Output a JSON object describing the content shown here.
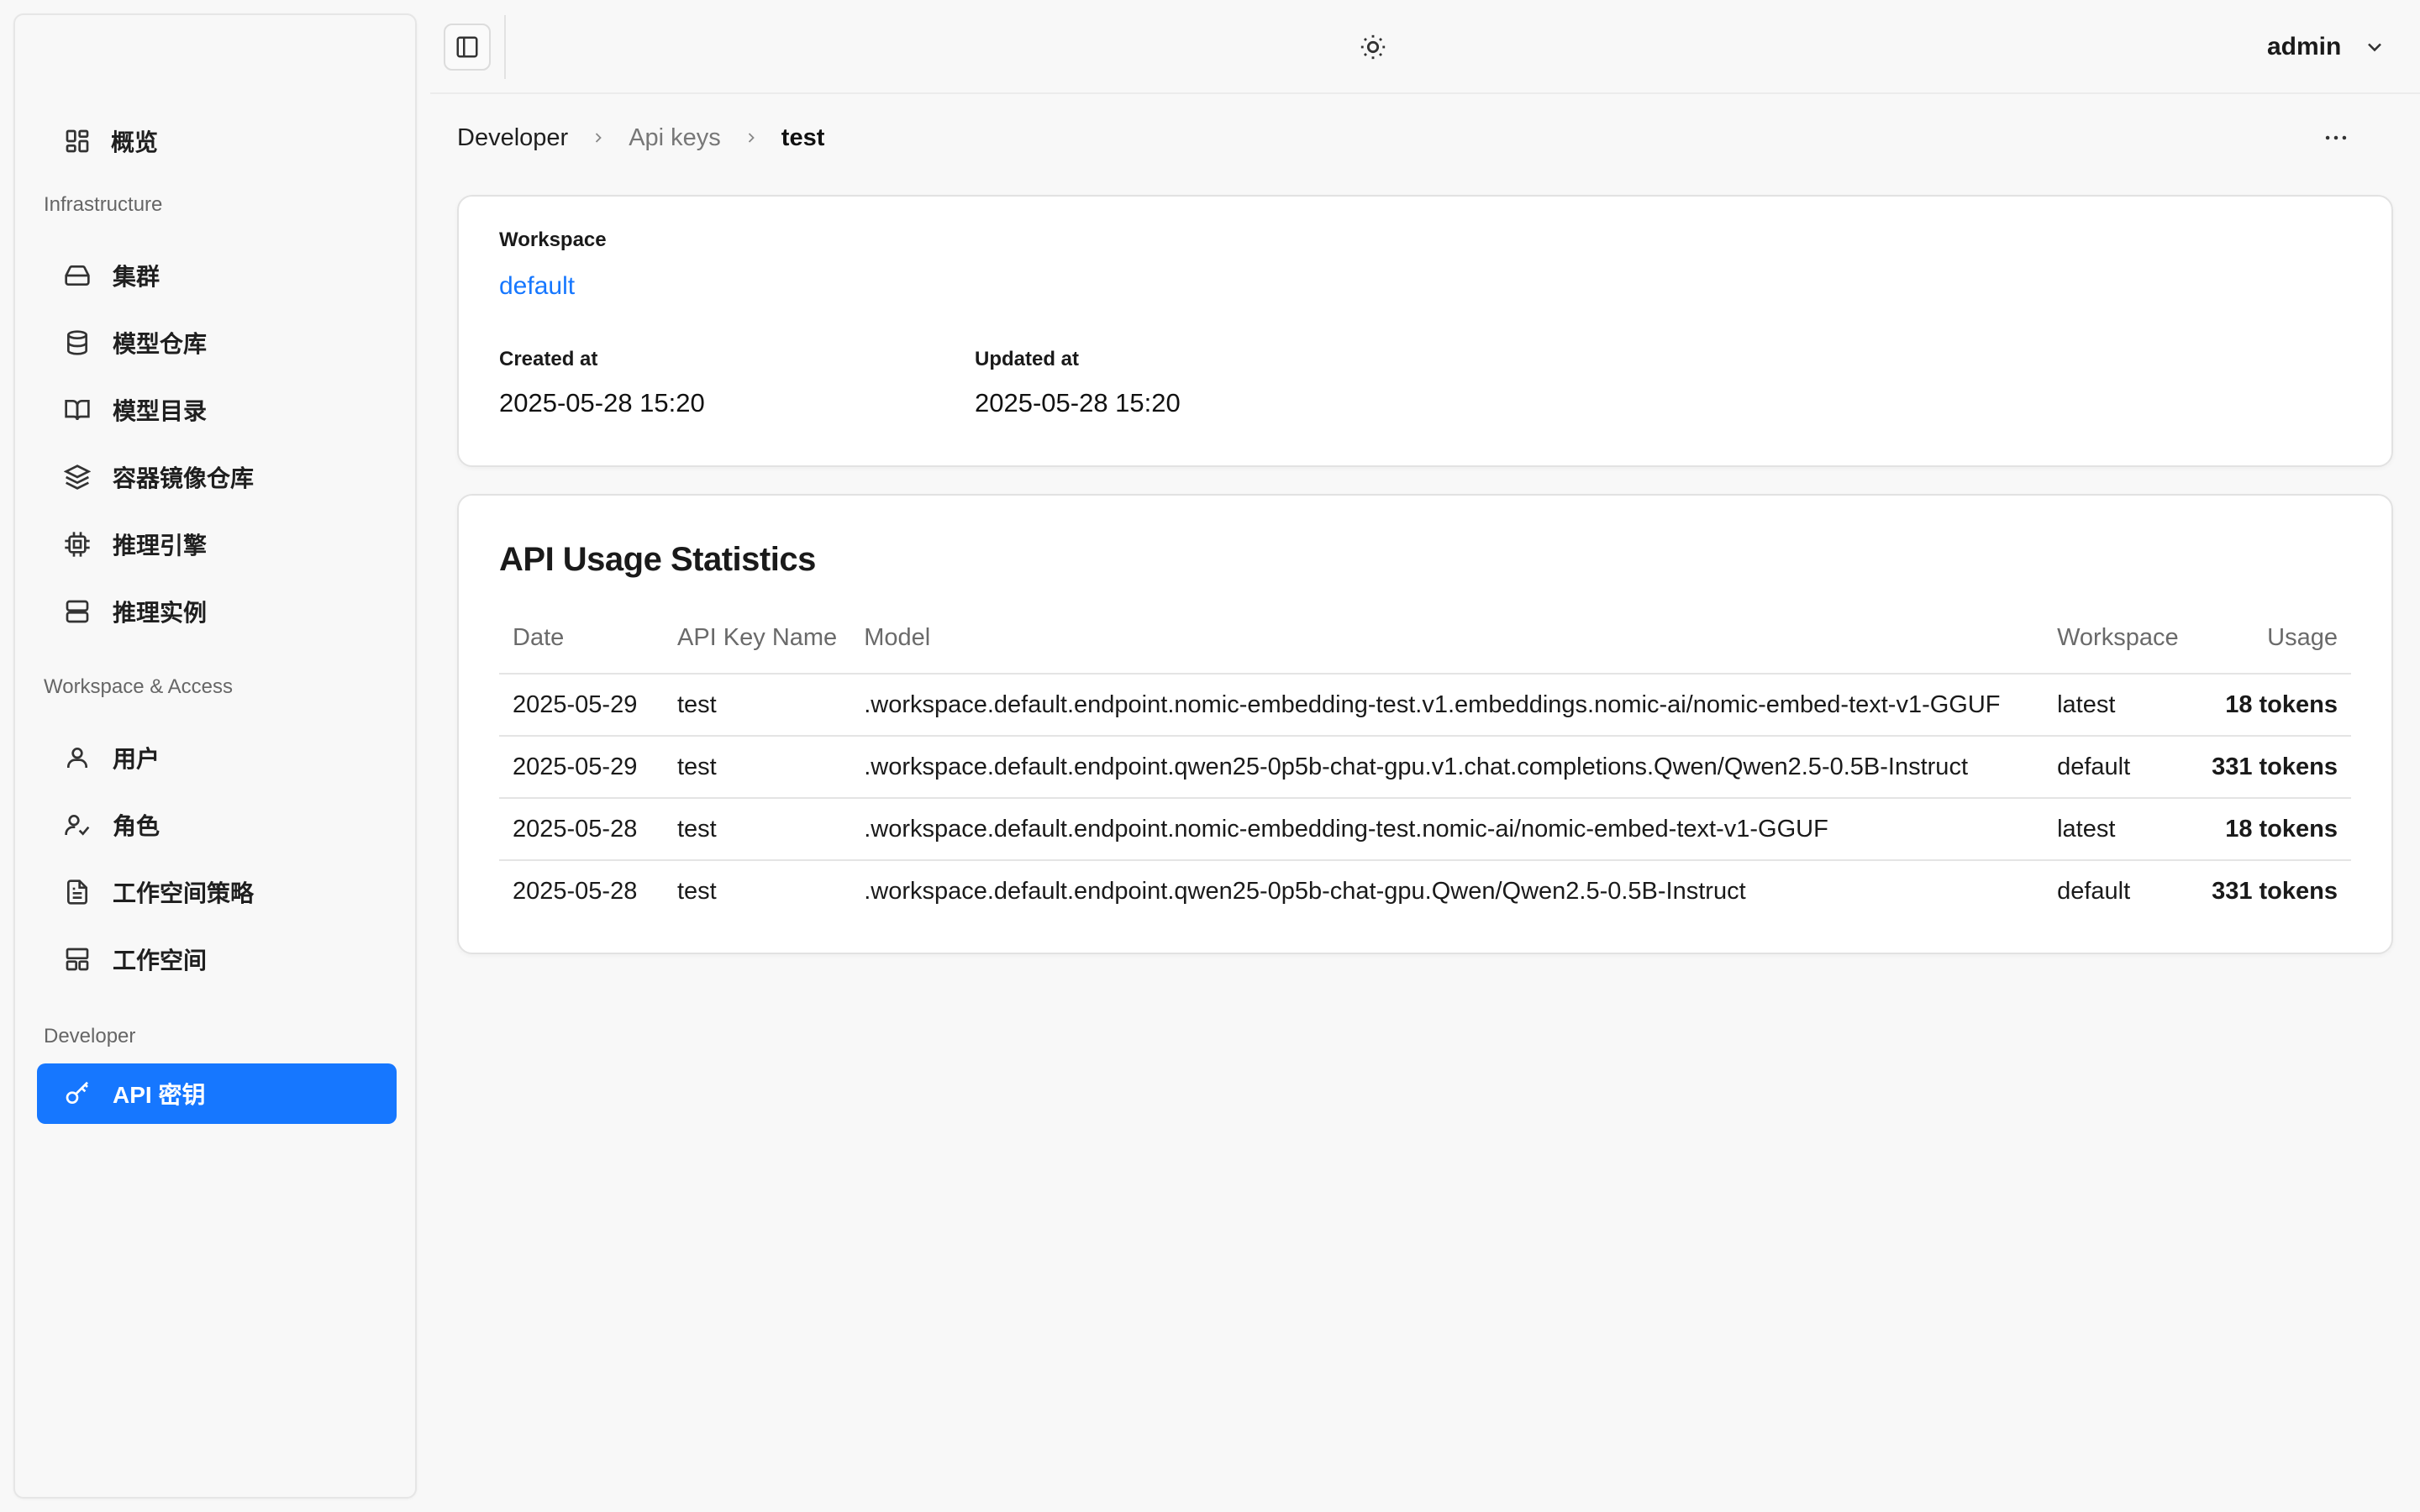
{
  "sidebar": {
    "overview_label": "概览",
    "sections": {
      "infrastructure": "Infrastructure",
      "workspace_access": "Workspace & Access",
      "developer": "Developer"
    },
    "infrastructure_items": [
      {
        "label": "集群",
        "icon": "hard-drive-icon"
      },
      {
        "label": "模型仓库",
        "icon": "database-icon"
      },
      {
        "label": "模型目录",
        "icon": "book-open-icon"
      },
      {
        "label": "容器镜像仓库",
        "icon": "layers-icon"
      },
      {
        "label": "推理引擎",
        "icon": "cpu-icon"
      },
      {
        "label": "推理实例",
        "icon": "server-icon"
      }
    ],
    "access_items": [
      {
        "label": "用户",
        "icon": "user-icon"
      },
      {
        "label": "角色",
        "icon": "user-check-icon"
      },
      {
        "label": "工作空间策略",
        "icon": "file-text-icon"
      },
      {
        "label": "工作空间",
        "icon": "layout-icon"
      }
    ],
    "developer_items": [
      {
        "label": "API 密钥",
        "icon": "key-icon",
        "active": true
      }
    ]
  },
  "header": {
    "user": "admin"
  },
  "breadcrumb": {
    "items": [
      "Developer",
      "Api keys",
      "test"
    ]
  },
  "details": {
    "workspace_label": "Workspace",
    "workspace_value": "default",
    "created_label": "Created at",
    "created_value": "2025-05-28 15:20",
    "updated_label": "Updated at",
    "updated_value": "2025-05-28 15:20"
  },
  "usage": {
    "title": "API Usage Statistics",
    "columns": [
      "Date",
      "API Key Name",
      "Model",
      "Workspace",
      "Usage"
    ],
    "rows": [
      {
        "date": "2025-05-29",
        "key": "test",
        "model": ".workspace.default.endpoint.nomic-embedding-test.v1.embeddings.nomic-ai/nomic-embed-text-v1-GGUF",
        "workspace": "latest",
        "usage": "18 tokens"
      },
      {
        "date": "2025-05-29",
        "key": "test",
        "model": ".workspace.default.endpoint.qwen25-0p5b-chat-gpu.v1.chat.completions.Qwen/Qwen2.5-0.5B-Instruct",
        "workspace": "default",
        "usage": "331 tokens"
      },
      {
        "date": "2025-05-28",
        "key": "test",
        "model": ".workspace.default.endpoint.nomic-embedding-test.nomic-ai/nomic-embed-text-v1-GGUF",
        "workspace": "latest",
        "usage": "18 tokens"
      },
      {
        "date": "2025-05-28",
        "key": "test",
        "model": ".workspace.default.endpoint.qwen25-0p5b-chat-gpu.Qwen/Qwen2.5-0.5B-Instruct",
        "workspace": "default",
        "usage": "331 tokens"
      }
    ]
  },
  "colors": {
    "accent": "#1677ff",
    "background": "#f8f8f8",
    "card": "#ffffff",
    "border": "#e2e2e2"
  }
}
